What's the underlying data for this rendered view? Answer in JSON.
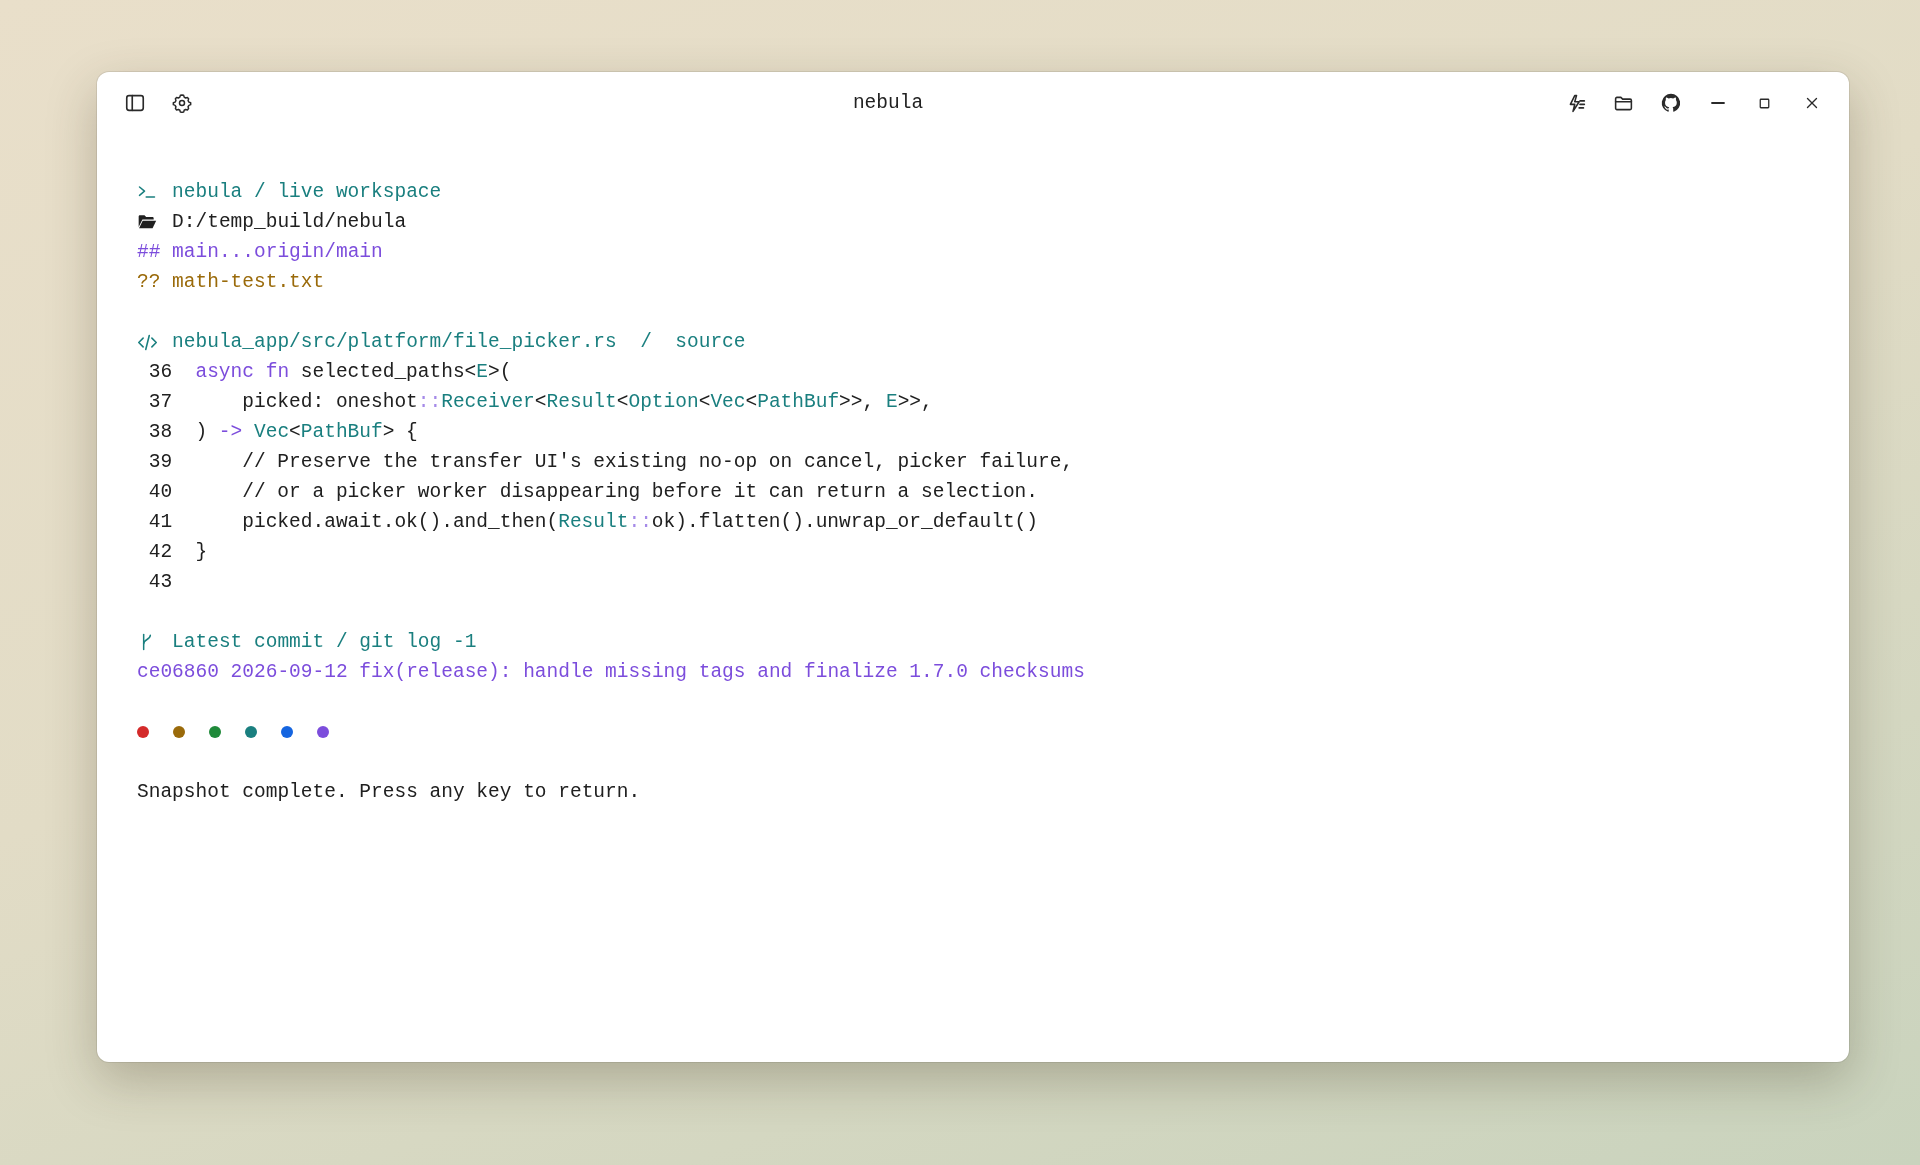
{
  "window": {
    "title": "nebula"
  },
  "status": [
    {
      "kind": "prompt",
      "text": "nebula / live workspace"
    },
    {
      "kind": "folder",
      "text": "D:/temp_build/nebula"
    },
    {
      "kind": "branch",
      "text": "## main...origin/main"
    },
    {
      "kind": "untracked",
      "text": "?? math-test.txt"
    }
  ],
  "source": {
    "header": "nebula_app/src/platform/file_picker.rs  /  source",
    "lines": [
      {
        "number": "36",
        "indented": false,
        "tokens": [
          {
            "text": "async fn",
            "kind": "keyword"
          },
          {
            "text": " selected_paths<",
            "kind": "plain"
          },
          {
            "text": "E",
            "kind": "type"
          },
          {
            "text": ">(",
            "kind": "plain"
          }
        ]
      },
      {
        "number": "37",
        "indented": true,
        "tokens": [
          {
            "text": "picked: oneshot",
            "kind": "plain"
          },
          {
            "text": "::",
            "kind": "punct"
          },
          {
            "text": "Receiver",
            "kind": "type"
          },
          {
            "text": "<",
            "kind": "plain"
          },
          {
            "text": "Result",
            "kind": "type"
          },
          {
            "text": "<",
            "kind": "plain"
          },
          {
            "text": "Option",
            "kind": "type"
          },
          {
            "text": "<",
            "kind": "plain"
          },
          {
            "text": "Vec",
            "kind": "type"
          },
          {
            "text": "<",
            "kind": "plain"
          },
          {
            "text": "PathBuf",
            "kind": "type"
          },
          {
            "text": ">>, ",
            "kind": "plain"
          },
          {
            "text": "E",
            "kind": "type"
          },
          {
            "text": ">>,",
            "kind": "plain"
          }
        ]
      },
      {
        "number": "38",
        "indented": false,
        "tokens": [
          {
            "text": ")",
            "kind": "plain"
          },
          {
            "text": " -> ",
            "kind": "keyword"
          },
          {
            "text": "Vec",
            "kind": "type"
          },
          {
            "text": "<",
            "kind": "plain"
          },
          {
            "text": "PathBuf",
            "kind": "type"
          },
          {
            "text": "> {",
            "kind": "plain"
          }
        ]
      },
      {
        "number": "39",
        "indented": true,
        "tokens": [
          {
            "text": "// Preserve the transfer UI's existing no-op on cancel, picker failure,",
            "kind": "plain"
          }
        ]
      },
      {
        "number": "40",
        "indented": true,
        "tokens": [
          {
            "text": "// or a picker worker disappearing before it can return a selection.",
            "kind": "plain"
          }
        ]
      },
      {
        "number": "41",
        "indented": true,
        "tokens": [
          {
            "text": "picked.await.ok().and_then(",
            "kind": "plain"
          },
          {
            "text": "Result",
            "kind": "type"
          },
          {
            "text": "::",
            "kind": "punct"
          },
          {
            "text": "ok).flatten().unwrap_or_default()",
            "kind": "plain"
          }
        ]
      },
      {
        "number": "42",
        "indented": false,
        "tokens": [
          {
            "text": "}",
            "kind": "plain"
          }
        ]
      },
      {
        "number": "43"
      }
    ]
  },
  "commit": {
    "header": "Latest commit / git log -1",
    "entry": "ce06860 2026-09-12 fix(release): handle missing tags and finalize 1.7.0 checksums"
  },
  "status_dots": [
    {
      "color": "#d42a2a"
    },
    {
      "color": "#9a6a0a"
    },
    {
      "color": "#1f8a3a"
    },
    {
      "color": "#1a7f7f"
    },
    {
      "color": "#1565e0"
    },
    {
      "color": "#7c4ddc"
    }
  ],
  "message": "Snapshot complete. Press any key to return."
}
